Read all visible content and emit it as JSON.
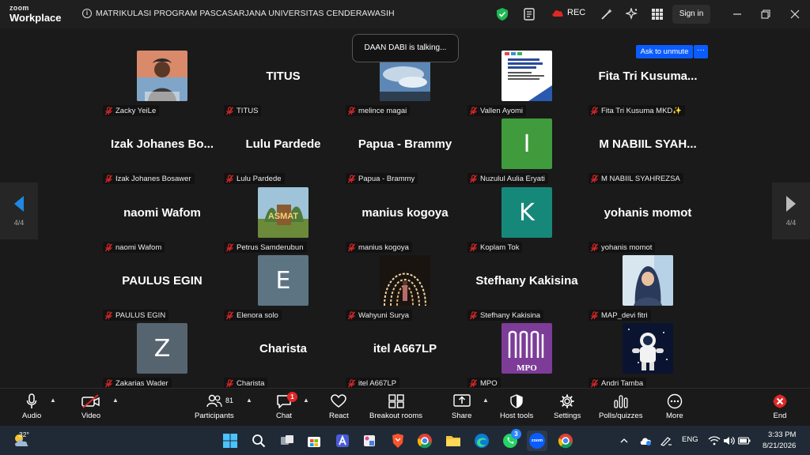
{
  "app": {
    "brand_small": "zoom",
    "brand_large": "Workplace"
  },
  "meeting": {
    "title": "MATRIKULASI PROGRAM PASCASARJANA UNIVERSITAS CENDERAWASIH",
    "rec_label": "REC",
    "signin_label": "Sign in"
  },
  "toast": {
    "text": "DAAN DABI is talking..."
  },
  "ask_unmute": {
    "label": "Ask to unmute",
    "more": "···"
  },
  "pager": {
    "left": "4/4",
    "right": "4/4"
  },
  "tiles": [
    {
      "type": "photo",
      "photo": "man-outdoor",
      "label": "Zacky YeiLe"
    },
    {
      "type": "name",
      "display": "TITUS",
      "label": "TITUS"
    },
    {
      "type": "photo",
      "photo": "sky",
      "label": "melince magai"
    },
    {
      "type": "photo",
      "photo": "poster",
      "label": "Vallen Ayomi"
    },
    {
      "type": "name",
      "display": "Fita Tri Kusuma...",
      "label": "Fita Tri Kusuma MKD✨"
    },
    {
      "type": "name",
      "display": "Izak Johanes Bo...",
      "label": "Izak Johanes Bosawer"
    },
    {
      "type": "name",
      "display": "Lulu Pardede",
      "label": "Lulu Pardede"
    },
    {
      "type": "name",
      "display": "Papua - Brammy",
      "label": "Papua - Brammy"
    },
    {
      "type": "letter",
      "letter": "I",
      "color": "#3f9b3c",
      "label": "Nuzulul Aulia Eryati"
    },
    {
      "type": "name",
      "display": "M NABIIL SYAH...",
      "label": "M NABIIL SYAHREZSA"
    },
    {
      "type": "name",
      "display": "naomi Wafom",
      "label": "naomi Wafom"
    },
    {
      "type": "photo",
      "photo": "asmat",
      "label": "Petrus Samderubun"
    },
    {
      "type": "name",
      "display": "manius kogoya",
      "label": "manius kogoya"
    },
    {
      "type": "letter",
      "letter": "K",
      "color": "#16887a",
      "label": "Koplam Tok"
    },
    {
      "type": "name",
      "display": "yohanis momot",
      "label": "yohanis momot"
    },
    {
      "type": "name",
      "display": "PAULUS EGIN",
      "label": "PAULUS EGIN"
    },
    {
      "type": "letter",
      "letter": "E",
      "color": "#5d7483",
      "label": "Elenora solo"
    },
    {
      "type": "photo",
      "photo": "tunnel",
      "label": "Wahyuni Surya"
    },
    {
      "type": "name",
      "display": "Stefhany Kakisina",
      "label": "Stefhany Kakisina"
    },
    {
      "type": "photo",
      "photo": "woman-hijab",
      "label": "MAP_devi fitri"
    },
    {
      "type": "letter",
      "letter": "Z",
      "color": "#566470",
      "label": "Zakarias Wader"
    },
    {
      "type": "name",
      "display": "Charista",
      "label": "Charista"
    },
    {
      "type": "name",
      "display": "itel A667LP",
      "label": "itel A667LP"
    },
    {
      "type": "photo",
      "photo": "mpo",
      "label": "MPO"
    },
    {
      "type": "photo",
      "photo": "astronaut",
      "label": "Andri Tamba"
    }
  ],
  "toolbar": {
    "audio": "Audio",
    "video": "Video",
    "participants": "Participants",
    "participants_count": "81",
    "chat": "Chat",
    "chat_badge": "1",
    "react": "React",
    "breakout": "Breakout rooms",
    "share": "Share",
    "host_tools": "Host tools",
    "settings": "Settings",
    "polls": "Polls/quizzes",
    "more": "More",
    "end": "End"
  },
  "taskbar": {
    "weather_temp": "32°",
    "lang": "ENG",
    "time": "3:33 PM",
    "date": "8/21/2026",
    "whatsapp_badge": "3",
    "zoom_label": "zoom"
  },
  "colors": {
    "accent_blue": "#0b5cff",
    "end_red": "#e02828",
    "mic_off_red": "#e02828"
  }
}
